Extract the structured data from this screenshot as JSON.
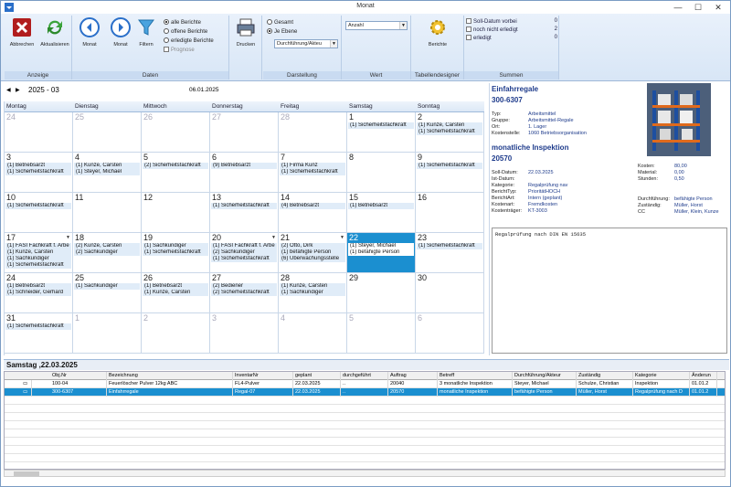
{
  "window": {
    "title": "Monat",
    "min": "—",
    "max": "☐",
    "close": "✕"
  },
  "ribbon": {
    "anzeige": {
      "title": "Anzeige",
      "abbrechen": "Abbrechen",
      "aktualisieren": "Aktualisieren"
    },
    "daten": {
      "title": "Daten",
      "monat_prev": "Monat",
      "monat_next": "Monat",
      "filtern": "Filtern",
      "opt_alle": "alle Berichte",
      "opt_offene": "offene Berichte",
      "opt_erledigte": "erledigte Berichte",
      "opt_prognose": "Prognose"
    },
    "drucken": "Drucken",
    "darstellung": {
      "title": "Darstellung",
      "opt_gesamt": "Gesamt",
      "opt_ebene": "Je Ebene",
      "combo": "Durchführung/Akteu"
    },
    "wert": {
      "title": "Wert",
      "combo": "Anzahl"
    },
    "tabellen": {
      "title": "Tabellendesigner",
      "berichte": "Berichte"
    },
    "summen": {
      "title": "Summen",
      "rows": [
        {
          "label": "Soll-Datum vorbei",
          "value": "0"
        },
        {
          "label": "noch nicht erledigt",
          "value": "2"
        },
        {
          "label": "erledigt",
          "value": "0"
        }
      ]
    }
  },
  "calendar": {
    "month": "2025 - 03",
    "date": "06.01.2025",
    "weekdays": [
      "Montag",
      "Dienstag",
      "Mittwoch",
      "Donnerstag",
      "Freitag",
      "Samstag",
      "Sonntag"
    ],
    "weeks": [
      [
        {
          "d": "24",
          "o": true,
          "e": []
        },
        {
          "d": "25",
          "o": true,
          "e": []
        },
        {
          "d": "26",
          "o": true,
          "e": []
        },
        {
          "d": "27",
          "o": true,
          "e": []
        },
        {
          "d": "28",
          "o": true,
          "e": []
        },
        {
          "d": "1",
          "e": [
            "(1) Sicherheitsfachkraft"
          ]
        },
        {
          "d": "2",
          "e": [
            "(1) Kunze, Carsten",
            "(1) Sicherheitsfachkraft"
          ]
        }
      ],
      [
        {
          "d": "3",
          "e": [
            "(1) Betriebsarzt",
            "(1) Sicherheitsfachkraft"
          ]
        },
        {
          "d": "4",
          "e": [
            "(1) Kunze, Carsten",
            "(1) Steyer, Michael"
          ]
        },
        {
          "d": "5",
          "e": [
            "(2) Sicherheitsfachkraft"
          ]
        },
        {
          "d": "6",
          "e": [
            "(9) Betriebsarzt"
          ]
        },
        {
          "d": "7",
          "e": [
            "(1) Firma Kunz",
            "(1) Sicherheitsfachkraft"
          ]
        },
        {
          "d": "8",
          "e": []
        },
        {
          "d": "9",
          "e": [
            "(1) Sicherheitsfachkraft"
          ]
        }
      ],
      [
        {
          "d": "10",
          "e": [
            "(1) Sicherheitsfachkraft"
          ]
        },
        {
          "d": "11",
          "e": []
        },
        {
          "d": "12",
          "e": []
        },
        {
          "d": "13",
          "e": [
            "(1) Sicherheitsfachkraft"
          ]
        },
        {
          "d": "14",
          "e": [
            "(4) Betriebsarzt"
          ]
        },
        {
          "d": "15",
          "e": [
            "(1) Betriebsarzt"
          ]
        },
        {
          "d": "16",
          "e": []
        }
      ],
      [
        {
          "d": "17",
          "m": true,
          "e": [
            "(1) FASI Fachkraft f. Arbe",
            "(1) Kunze, Carsten",
            "(1) Sachkundiger",
            "(1) Sicherheitsfachkraft"
          ]
        },
        {
          "d": "18",
          "e": [
            "(2) Kunze, Carsten",
            "(2) Sachkundiger"
          ]
        },
        {
          "d": "19",
          "e": [
            "(1) Sachkundiger",
            "(1) Sicherheitsfachkraft"
          ]
        },
        {
          "d": "20",
          "m": true,
          "e": [
            "(1) FASI Fachkraft f. Arbe",
            "(2) Sachkundiger",
            "(1) Sicherheitsfachkraft"
          ]
        },
        {
          "d": "21",
          "m": true,
          "e": [
            "(2) Otto, Dirk",
            "(1) befähigte Person",
            "(6) Überwachungsstelle"
          ]
        },
        {
          "d": "22",
          "s": true,
          "e": [
            "(1) Steyer, Michael",
            "(1) befähigte Person"
          ]
        },
        {
          "d": "23",
          "e": [
            "(1) Sicherheitsfachkraft"
          ]
        }
      ],
      [
        {
          "d": "24",
          "e": [
            "(1) Betriebsarzt",
            "(1) Schneider, Gerhard"
          ]
        },
        {
          "d": "25",
          "e": [
            "(1) Sachkundiger"
          ]
        },
        {
          "d": "26",
          "e": [
            "(1) Betriebsarzt",
            "(1) Kunze, Carsten"
          ]
        },
        {
          "d": "27",
          "e": [
            "(2) Bediener",
            "(2) Sicherheitsfachkraft"
          ]
        },
        {
          "d": "28",
          "e": [
            "(1) Kunze, Carsten",
            "(1) Sachkundiger"
          ]
        },
        {
          "d": "29",
          "e": []
        },
        {
          "d": "30",
          "e": []
        }
      ],
      [
        {
          "d": "31",
          "e": [
            "(1) Sicherheitsfachkraft"
          ]
        },
        {
          "d": "1",
          "o": true,
          "e": []
        },
        {
          "d": "2",
          "o": true,
          "e": []
        },
        {
          "d": "3",
          "o": true,
          "e": []
        },
        {
          "d": "4",
          "o": true,
          "e": []
        },
        {
          "d": "5",
          "o": true,
          "e": []
        },
        {
          "d": "6",
          "o": true,
          "e": []
        }
      ]
    ]
  },
  "detail": {
    "title": "Einfahrregale",
    "id": "300-6307",
    "fields1": [
      {
        "k": "Typ:",
        "v": "Arbeitsmittel"
      },
      {
        "k": "Gruppe:",
        "v": "Arbeitsmittel-Regale"
      },
      {
        "k": "Ort:",
        "v": "1. Lager"
      },
      {
        "k": "Kostenstelle:",
        "v": "1060 Betriebsorganisation"
      }
    ],
    "inspection": "monatliche Inspektion",
    "inspection_id": "20570",
    "fields2": [
      {
        "k": "Soll-Datum:",
        "v": "22.03.2025"
      },
      {
        "k": "Ist-Datum:",
        "v": ""
      },
      {
        "k": "Kategorie:",
        "v": "Regalprüfung nav"
      },
      {
        "k": "BerichtTyp:",
        "v": "PrioritätHOCH"
      },
      {
        "k": "BerichtArt:",
        "v": "Intern (geplant)"
      },
      {
        "k": "Kostenart:",
        "v": "Fremdkosten"
      },
      {
        "k": "Kostenträger:",
        "v": "KT-3003"
      }
    ],
    "costs": [
      {
        "k": "Kosten:",
        "v": "80,00"
      },
      {
        "k": "Material:",
        "v": "0,00"
      },
      {
        "k": "Stunden:",
        "v": "0,50"
      }
    ],
    "resp": [
      {
        "k": "Durchführung:",
        "v": "befähigte Person"
      },
      {
        "k": "Zuständig:",
        "v": "Müller, Horst"
      },
      {
        "k": "CC",
        "v": "Müller, Klein, Kunze"
      }
    ],
    "memo": "Regalprüfung nach DIN EN 15635"
  },
  "list": {
    "title": "Samstag ,22.03.2025",
    "columns": [
      "Obj.Nr",
      "Bezeichnung",
      "InventarNr",
      "geplant",
      "durchgeführt",
      "Auftrag",
      "Betreff",
      "Durchführung/Akteur",
      "Zuständig",
      "Kategorie",
      "Änderun"
    ],
    "rows": [
      [
        "100-04",
        "Feuerlöscher Pulver 12kg ABC",
        "FL4-Pulver",
        "22.03.2025",
        "..",
        "20040",
        "3 monatliche Inspektion",
        "Steyer, Michael",
        "Schulze, Christian",
        "Inspektion",
        "01.01.2"
      ],
      [
        "300-6307",
        "Einfahrregale",
        "Regal-07",
        "22.03.2025",
        "..",
        "20570",
        "monatliche Inspektion",
        "befähigte Person",
        "Müller, Horst",
        "Regalprüfung nach D",
        "01.01.2"
      ]
    ]
  }
}
